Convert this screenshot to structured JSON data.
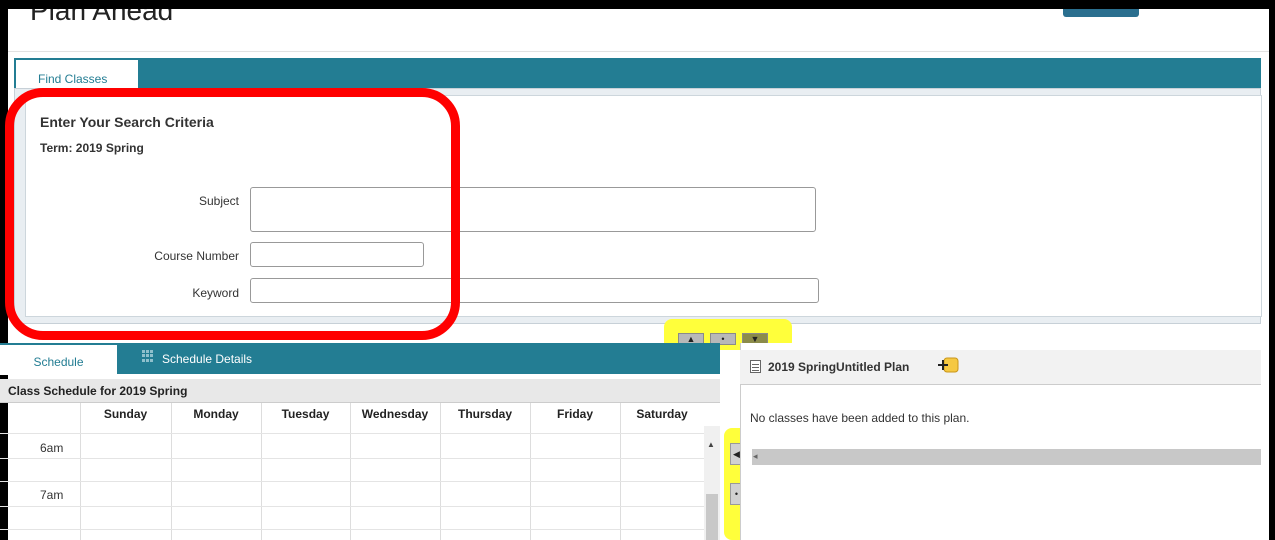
{
  "page": {
    "title": "Plan Ahead"
  },
  "find_classes": {
    "tab_label": "Find Classes",
    "heading": "Enter Your Search Criteria",
    "term": "Term: 2019 Spring",
    "fields": {
      "subject_label": "Subject",
      "subject_value": "",
      "course_number_label": "Course Number",
      "course_number_value": "",
      "keyword_label": "Keyword",
      "keyword_value": ""
    }
  },
  "splitter": {
    "up_glyph": "▲",
    "dot_glyph": "•",
    "down_glyph": "▼",
    "left_glyph": "◀"
  },
  "schedule": {
    "tabs": [
      {
        "label": "Schedule"
      },
      {
        "label": "Schedule Details"
      }
    ],
    "caption": "Class Schedule for 2019 Spring",
    "days": [
      "Sunday",
      "Monday",
      "Tuesday",
      "Wednesday",
      "Thursday",
      "Friday",
      "Saturday"
    ],
    "hours": [
      "6am",
      "7am"
    ]
  },
  "plan": {
    "title": "2019 SpringUntitled Plan",
    "empty_message": "No classes have been added to this plan."
  },
  "colors": {
    "accent": "#237d93",
    "highlight_red": "#ff0000",
    "highlight_yellow": "#ffff3b"
  },
  "icons": {
    "plan_doc": "document-icon",
    "plan_add": "add-note-icon",
    "details_grid": "grid-icon"
  }
}
